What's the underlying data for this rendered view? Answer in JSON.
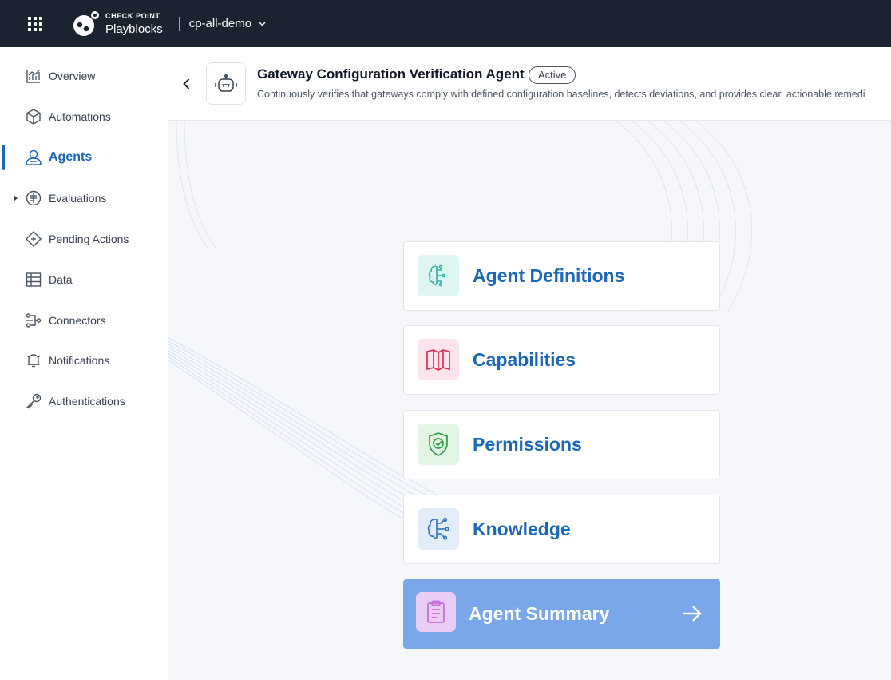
{
  "topbar": {
    "brand_top": "CHECK POINT",
    "brand_bottom": "Playblocks",
    "tenant": "cp-all-demo"
  },
  "sidebar": {
    "items": [
      {
        "label": "Overview",
        "icon": "chart-icon"
      },
      {
        "label": "Automations",
        "icon": "cube-icon"
      },
      {
        "label": "Agents",
        "icon": "agent-icon",
        "active": true
      },
      {
        "label": "Evaluations",
        "icon": "evaluations-icon",
        "expandable": true
      },
      {
        "label": "Pending Actions",
        "icon": "diamond-icon"
      },
      {
        "label": "Data",
        "icon": "table-icon"
      },
      {
        "label": "Connectors",
        "icon": "connectors-icon"
      },
      {
        "label": "Notifications",
        "icon": "bell-icon"
      },
      {
        "label": "Authentications",
        "icon": "key-icon"
      }
    ]
  },
  "header": {
    "title": "Gateway Configuration Verification Agent",
    "status": "Active",
    "description": "Continuously verifies that gateways comply with defined configuration baselines, detects deviations, and provides clear, actionable remedi"
  },
  "cards": [
    {
      "label": "Agent Definitions",
      "icon": "definitions-icon",
      "accent": "#2bb3a3"
    },
    {
      "label": "Capabilities",
      "icon": "map-icon",
      "accent": "#d9315a"
    },
    {
      "label": "Permissions",
      "icon": "shield-icon",
      "accent": "#2e9e44"
    },
    {
      "label": "Knowledge",
      "icon": "knowledge-icon",
      "accent": "#2f72c4"
    },
    {
      "label": "Agent Summary",
      "icon": "document-icon",
      "accent": "#c56bd6"
    }
  ],
  "colors": {
    "topbar_bg": "#1b2230",
    "primary": "#1d67b8",
    "summary_bg": "#7aa6ea"
  }
}
